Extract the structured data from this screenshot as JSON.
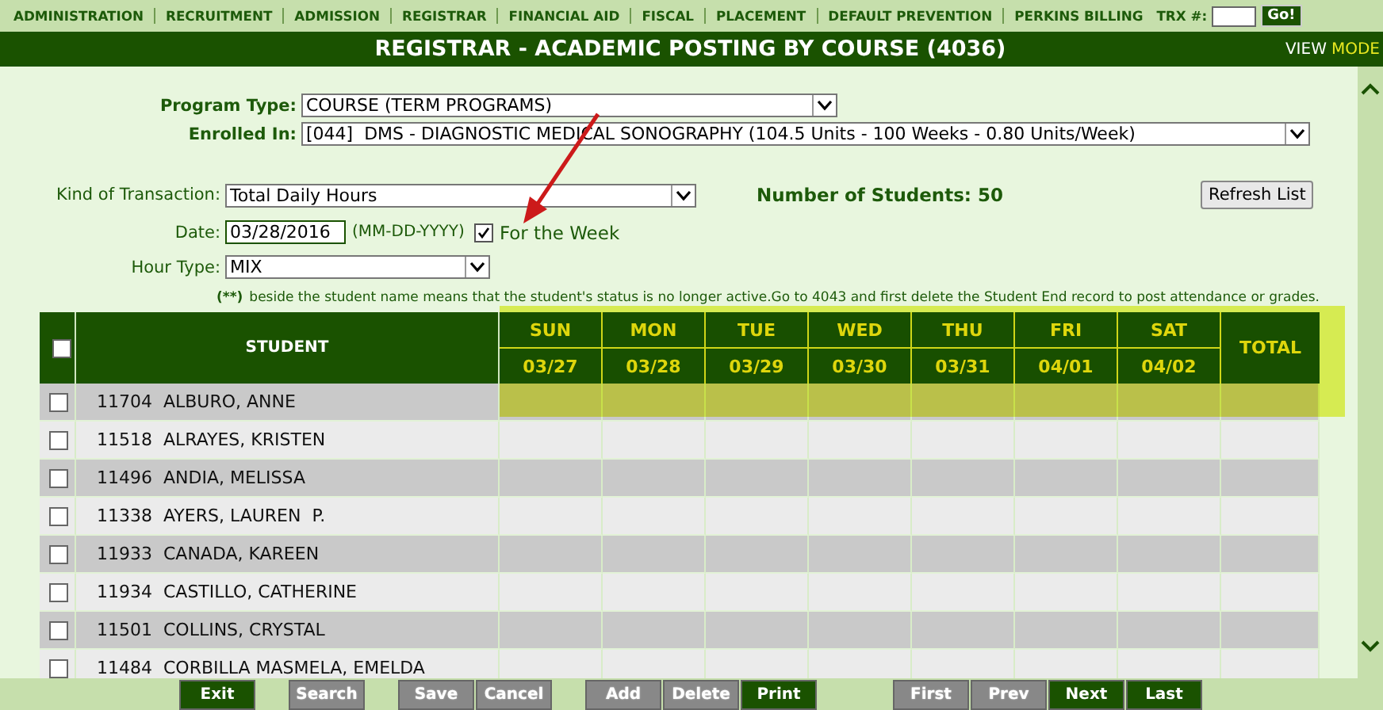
{
  "nav": {
    "items": [
      "ADMINISTRATION",
      "RECRUITMENT",
      "ADMISSION",
      "REGISTRAR",
      "FINANCIAL AID",
      "FISCAL",
      "PLACEMENT",
      "DEFAULT PREVENTION",
      "PERKINS BILLING"
    ],
    "trx_label": "TRX #:",
    "go_button": "Go!"
  },
  "title": "REGISTRAR - ACADEMIC POSTING BY COURSE (4036)",
  "view_label": "VIEW",
  "mode_label": "MODE",
  "form": {
    "program_type": {
      "label": "Program Type:",
      "value": "COURSE (TERM PROGRAMS)"
    },
    "enrolled_in": {
      "label": "Enrolled In:",
      "value": "[044]  DMS - DIAGNOSTIC MEDICAL SONOGRAPHY (104.5 Units - 100 Weeks - 0.80 Units/Week)"
    },
    "kind_of_transaction": {
      "label": "Kind of Transaction:",
      "value": "Total Daily Hours"
    },
    "number_of_students": "Number of Students: 50",
    "refresh_button": "Refresh List",
    "date": {
      "label": "Date:",
      "value": "03/28/2016",
      "format_hint": "(MM-DD-YYYY)"
    },
    "for_the_week": {
      "label": "For the Week",
      "checked": true
    },
    "hour_type": {
      "label": "Hour Type:",
      "value": "MIX"
    },
    "note_marker": "(**)",
    "note": "beside the student name means that the student's status is no longer active.Go to 4043 and first delete the Student End record to post attendance or grades."
  },
  "table": {
    "select_all_checked": false,
    "student_header": "STUDENT",
    "total_header": "TOTAL",
    "days": [
      {
        "day": "SUN",
        "date": "03/27"
      },
      {
        "day": "MON",
        "date": "03/28"
      },
      {
        "day": "TUE",
        "date": "03/29"
      },
      {
        "day": "WED",
        "date": "03/30"
      },
      {
        "day": "THU",
        "date": "03/31"
      },
      {
        "day": "FRI",
        "date": "04/01"
      },
      {
        "day": "SAT",
        "date": "04/02"
      }
    ],
    "rows": [
      {
        "student": "11704  ALBURO, ANNE",
        "checked": false
      },
      {
        "student": "11518  ALRAYES, KRISTEN",
        "checked": false
      },
      {
        "student": "11496  ANDIA, MELISSA",
        "checked": false
      },
      {
        "student": "11338  AYERS, LAUREN  P.",
        "checked": false
      },
      {
        "student": "11933  CANADA, KAREEN",
        "checked": false
      },
      {
        "student": "11934  CASTILLO, CATHERINE",
        "checked": false
      },
      {
        "student": "11501  COLLINS, CRYSTAL",
        "checked": false
      },
      {
        "student": "11484  CORBILLA MASMELA, EMELDA",
        "checked": false
      }
    ]
  },
  "button_groups": [
    [
      {
        "label": "Exit",
        "disabled": false
      }
    ],
    [
      {
        "label": "Search",
        "disabled": true
      }
    ],
    [
      {
        "label": "Save",
        "disabled": true
      },
      {
        "label": "Cancel",
        "disabled": true
      }
    ],
    [
      {
        "label": "Add",
        "disabled": true
      },
      {
        "label": "Delete",
        "disabled": true
      },
      {
        "label": "Print",
        "disabled": false
      }
    ],
    [
      {
        "label": "First",
        "disabled": true
      },
      {
        "label": "Prev",
        "disabled": true
      },
      {
        "label": "Next",
        "disabled": false
      },
      {
        "label": "Last",
        "disabled": false
      }
    ]
  ]
}
